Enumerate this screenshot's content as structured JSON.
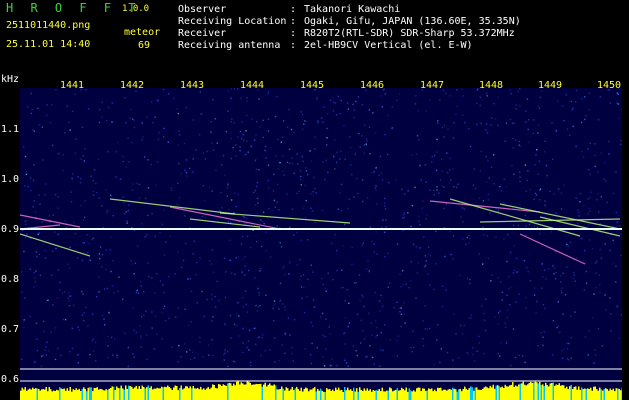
{
  "header": {
    "brand": "H R O F F T",
    "version": "1.0.0",
    "filename": "2511011440.png",
    "datetime": "25.11.01 14:40",
    "meteor_label": "meteor",
    "meteor_count": "69"
  },
  "info": [
    {
      "key": "Observer",
      "value": "Takanori Kawachi"
    },
    {
      "key": "Receiving Location",
      "value": "Ogaki, Gifu, JAPAN (136.60E, 35.35N)"
    },
    {
      "key": "Receiver",
      "value": "R820T2(RTL-SDR) SDR-Sharp 53.372MHz"
    },
    {
      "key": "Receiving antenna",
      "value": "2el-HB9CV Vertical (el. E-W)"
    }
  ],
  "spectrogram": {
    "unit": "kHz",
    "x_ticks": [
      "1441",
      "1442",
      "1443",
      "1444",
      "1445",
      "1446",
      "1447",
      "1448",
      "1449",
      "1450"
    ],
    "y_ticks": [
      "1.1",
      "1.0",
      "0.9",
      "0.8",
      "0.7",
      "0.6"
    ],
    "x_range": [
      1440.6,
      1450.4
    ],
    "y_range": [
      0.6,
      1.2
    ],
    "carrier_khz": 0.9,
    "colors": {
      "background": "#000040",
      "noise": "#2a3fd0",
      "carrier": "#e6ffee",
      "trail": "#c0ff80",
      "level": "#ffff00",
      "level_base": "#00c8ff",
      "axis": "#ffffff"
    }
  }
}
